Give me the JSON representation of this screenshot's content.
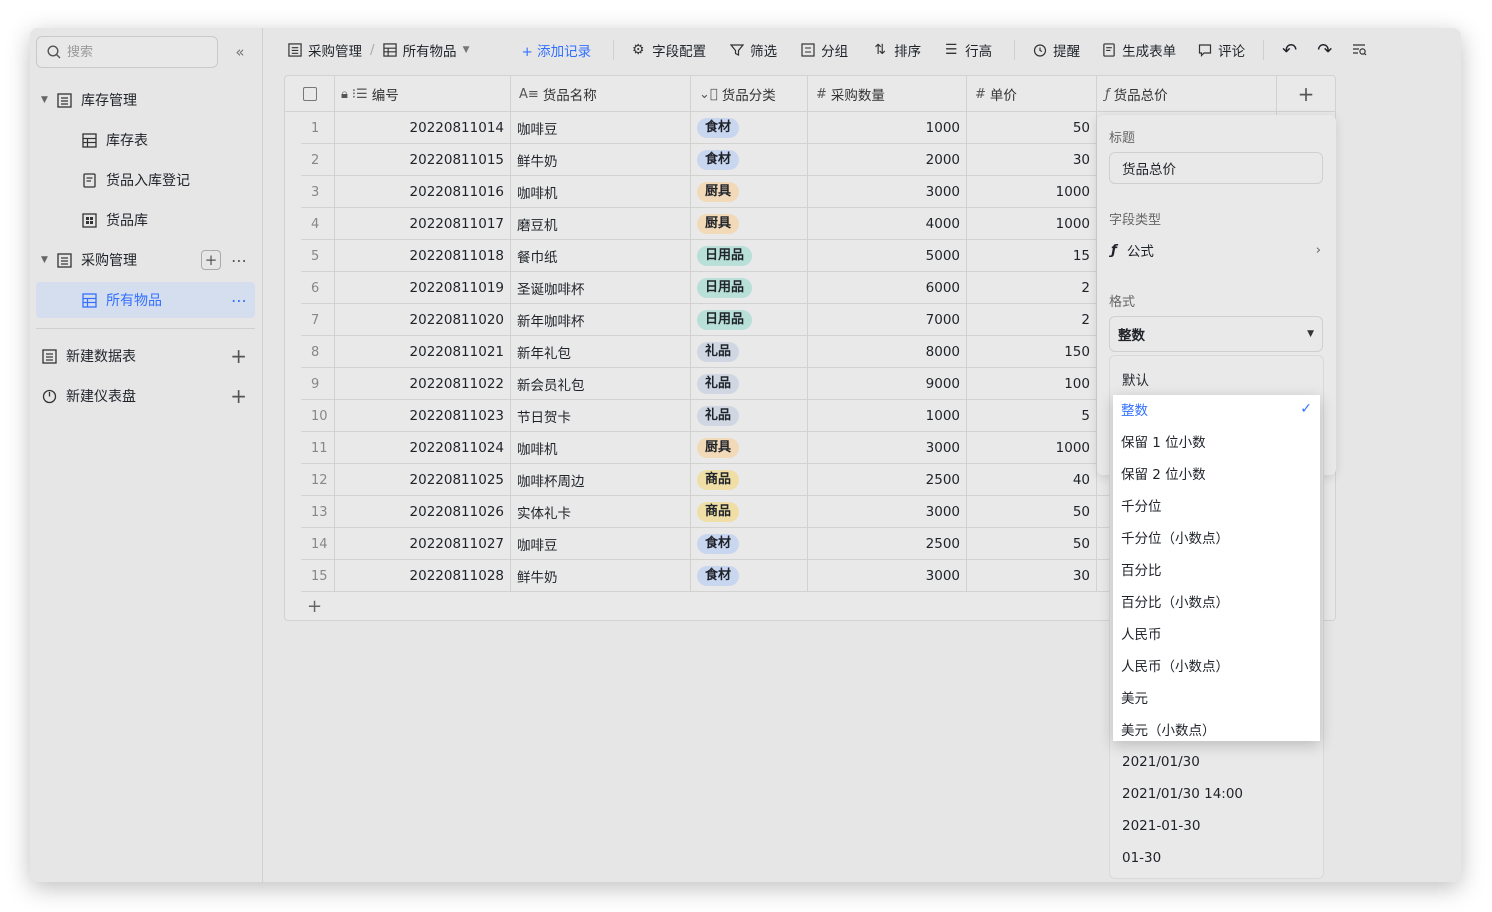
{
  "search": {
    "placeholder": "搜索"
  },
  "sidebar": {
    "items": [
      {
        "label": "库存管理"
      },
      {
        "label": "库存表"
      },
      {
        "label": "货品入库登记"
      },
      {
        "label": "货品库"
      },
      {
        "label": "采购管理"
      },
      {
        "label": "所有物品"
      },
      {
        "label": "新建数据表"
      },
      {
        "label": "新建仪表盘"
      }
    ]
  },
  "toolbar": {
    "breadcrumb_base": "采购管理",
    "breadcrumb_view": "所有物品",
    "add_record": "+ 添加记录",
    "field_config": "字段配置",
    "filter": "筛选",
    "group": "分组",
    "sort": "排序",
    "row_height": "行高",
    "reminder": "提醒",
    "form": "生成表单",
    "comment": "评论"
  },
  "table": {
    "headers": {
      "code": "编号",
      "name": "货品名称",
      "category": "货品分类",
      "qty": "采购数量",
      "price": "单价",
      "total": "货品总价"
    },
    "rows": [
      {
        "idx": "1",
        "code": "20220811014",
        "name": "咖啡豆",
        "cat": "食材",
        "qty": "1000",
        "price": "50"
      },
      {
        "idx": "2",
        "code": "20220811015",
        "name": "鲜牛奶",
        "cat": "食材",
        "qty": "2000",
        "price": "30"
      },
      {
        "idx": "3",
        "code": "20220811016",
        "name": "咖啡机",
        "cat": "厨具",
        "qty": "3000",
        "price": "1000"
      },
      {
        "idx": "4",
        "code": "20220811017",
        "name": "磨豆机",
        "cat": "厨具",
        "qty": "4000",
        "price": "1000"
      },
      {
        "idx": "5",
        "code": "20220811018",
        "name": "餐巾纸",
        "cat": "日用品",
        "qty": "5000",
        "price": "15"
      },
      {
        "idx": "6",
        "code": "20220811019",
        "name": "圣诞咖啡杯",
        "cat": "日用品",
        "qty": "6000",
        "price": "2"
      },
      {
        "idx": "7",
        "code": "20220811020",
        "name": "新年咖啡杯",
        "cat": "日用品",
        "qty": "7000",
        "price": "2"
      },
      {
        "idx": "8",
        "code": "20220811021",
        "name": "新年礼包",
        "cat": "礼品",
        "qty": "8000",
        "price": "150"
      },
      {
        "idx": "9",
        "code": "20220811022",
        "name": "新会员礼包",
        "cat": "礼品",
        "qty": "9000",
        "price": "100"
      },
      {
        "idx": "10",
        "code": "20220811023",
        "name": "节日贺卡",
        "cat": "礼品",
        "qty": "1000",
        "price": "5"
      },
      {
        "idx": "11",
        "code": "20220811024",
        "name": "咖啡机",
        "cat": "厨具",
        "qty": "3000",
        "price": "1000"
      },
      {
        "idx": "12",
        "code": "20220811025",
        "name": "咖啡杯周边",
        "cat": "商品",
        "qty": "2500",
        "price": "40"
      },
      {
        "idx": "13",
        "code": "20220811026",
        "name": "实体礼卡",
        "cat": "商品",
        "qty": "3000",
        "price": "50"
      },
      {
        "idx": "14",
        "code": "20220811027",
        "name": "咖啡豆",
        "cat": "食材",
        "qty": "2500",
        "price": "50"
      },
      {
        "idx": "15",
        "code": "20220811028",
        "name": "鲜牛奶",
        "cat": "食材",
        "qty": "3000",
        "price": "30"
      }
    ],
    "tag_colors": {
      "食材": "#c9d6f0",
      "厨具": "#f2d9b8",
      "日用品": "#b8e0d8",
      "礼品": "#d0d7e3",
      "商品": "#efdfa6"
    }
  },
  "panel": {
    "title_label": "标题",
    "title_value": "货品总价",
    "type_label": "字段类型",
    "type_value": "公式",
    "format_label": "格式",
    "format_value": "整数"
  },
  "format_options": {
    "default": "默认",
    "list": [
      "整数",
      "保留 1 位小数",
      "保留 2 位小数",
      "千分位",
      "千分位（小数点）",
      "百分比",
      "百分比（小数点）",
      "人民币",
      "人民币（小数点）",
      "美元",
      "美元（小数点）"
    ],
    "selected": "整数",
    "dates": [
      "2021/01/30",
      "2021/01/30 14:00",
      "2021-01-30",
      "01-30"
    ]
  },
  "colors": {
    "accent": "#3370ff"
  }
}
